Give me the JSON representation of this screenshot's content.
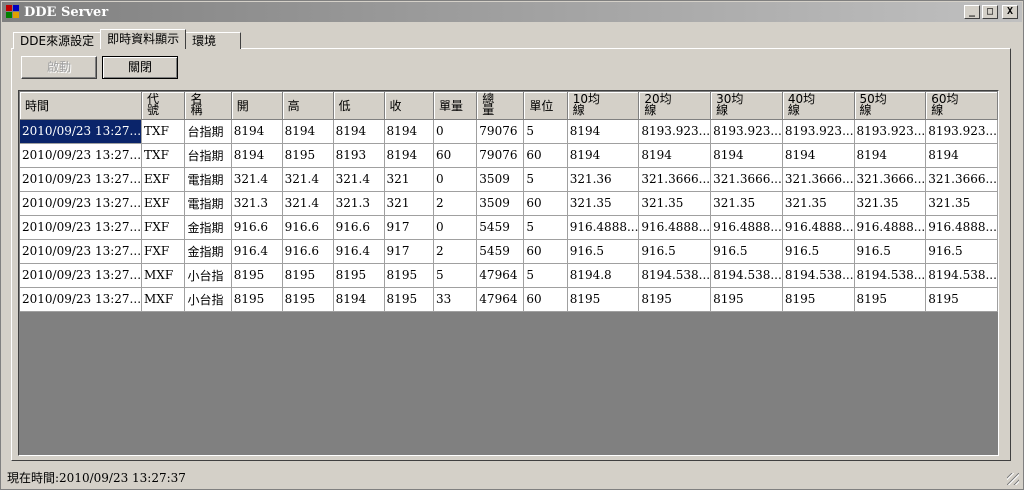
{
  "window": {
    "title": "DDE Server"
  },
  "title_buttons": {
    "minimize": "_",
    "maximize": "□",
    "close": "X"
  },
  "tabs": [
    {
      "label": "DDE來源設定"
    },
    {
      "label": "即時資料顯示"
    },
    {
      "label": "環境"
    }
  ],
  "buttons": {
    "start": "啟動",
    "close": "關閉"
  },
  "grid": {
    "headers": [
      [
        "時間"
      ],
      [
        "代",
        "號"
      ],
      [
        "名",
        "稱"
      ],
      [
        "開"
      ],
      [
        "高"
      ],
      [
        "低"
      ],
      [
        "收"
      ],
      [
        "單量"
      ],
      [
        "總",
        "量"
      ],
      [
        "單位"
      ],
      [
        "10均",
        "線"
      ],
      [
        "20均",
        "線"
      ],
      [
        "30均",
        "線"
      ],
      [
        "40均",
        "線"
      ],
      [
        "50均",
        "線"
      ],
      [
        "60均",
        "線"
      ]
    ],
    "rows": [
      [
        "2010/09/23 13:27...",
        "TXF",
        "台指期",
        "8194",
        "8194",
        "8194",
        "8194",
        "0",
        "79076",
        "5",
        "8194",
        "8193.923...",
        "8193.923...",
        "8193.923...",
        "8193.923...",
        "8193.923..."
      ],
      [
        "2010/09/23 13:27...",
        "TXF",
        "台指期",
        "8194",
        "8195",
        "8193",
        "8194",
        "60",
        "79076",
        "60",
        "8194",
        "8194",
        "8194",
        "8194",
        "8194",
        "8194"
      ],
      [
        "2010/09/23 13:27...",
        "EXF",
        "電指期",
        "321.4",
        "321.4",
        "321.4",
        "321",
        "0",
        "3509",
        "5",
        "321.36",
        "321.3666...",
        "321.3666...",
        "321.3666...",
        "321.3666...",
        "321.3666..."
      ],
      [
        "2010/09/23 13:27...",
        "EXF",
        "電指期",
        "321.3",
        "321.4",
        "321.3",
        "321",
        "2",
        "3509",
        "60",
        "321.35",
        "321.35",
        "321.35",
        "321.35",
        "321.35",
        "321.35"
      ],
      [
        "2010/09/23 13:27...",
        "FXF",
        "金指期",
        "916.6",
        "916.6",
        "916.6",
        "917",
        "0",
        "5459",
        "5",
        "916.4888...",
        "916.4888...",
        "916.4888...",
        "916.4888...",
        "916.4888...",
        "916.4888..."
      ],
      [
        "2010/09/23 13:27...",
        "FXF",
        "金指期",
        "916.4",
        "916.6",
        "916.4",
        "917",
        "2",
        "5459",
        "60",
        "916.5",
        "916.5",
        "916.5",
        "916.5",
        "916.5",
        "916.5"
      ],
      [
        "2010/09/23 13:27...",
        "MXF",
        "小台指",
        "8195",
        "8195",
        "8195",
        "8195",
        "5",
        "47964",
        "5",
        "8194.8",
        "8194.538...",
        "8194.538...",
        "8194.538...",
        "8194.538...",
        "8194.538..."
      ],
      [
        "2010/09/23 13:27...",
        "MXF",
        "小台指",
        "8195",
        "8195",
        "8194",
        "8195",
        "33",
        "47964",
        "60",
        "8195",
        "8195",
        "8195",
        "8195",
        "8195",
        "8195"
      ]
    ]
  },
  "status": {
    "text": "現在時間:2010/09/23 13:27:37"
  },
  "colors": {
    "selection": "#0a246a",
    "face": "#d4d0c8",
    "grid_bg": "#808080"
  }
}
